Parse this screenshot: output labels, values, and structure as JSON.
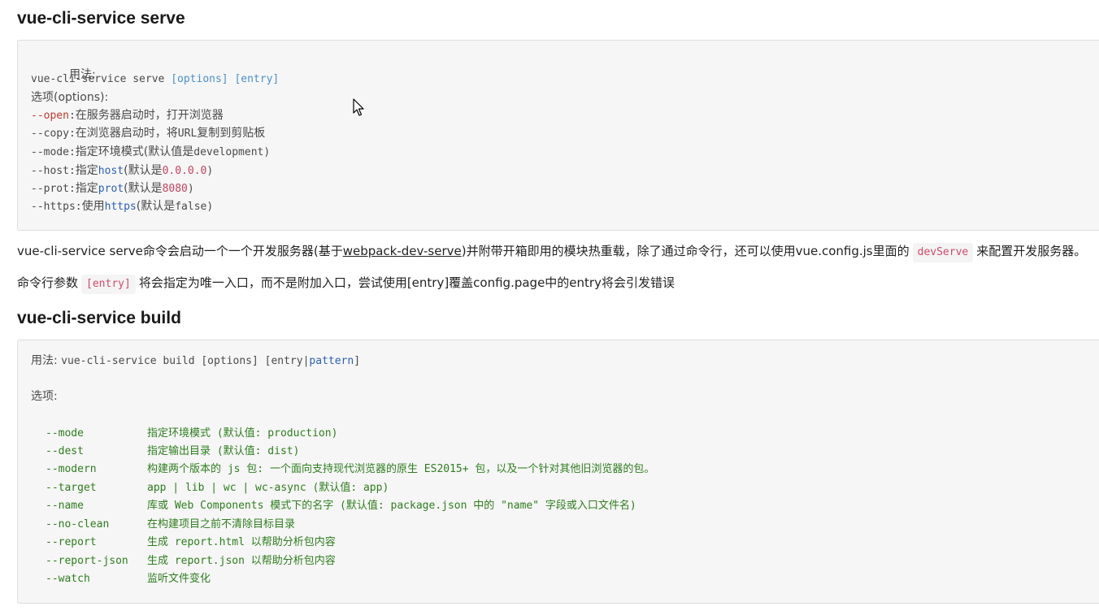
{
  "section1": {
    "heading": "vue-cli-service serve",
    "code": {
      "usage_label": "用法:",
      "usage_cmd": "vue-cli-service serve ",
      "usage_opts": "[options] [entry]",
      "options_label": "选项(options):",
      "lines": [
        {
          "flag": "--open",
          "sep": ":",
          "desc": "在服务器启动时，打开浏览器"
        },
        {
          "flag": "--copy",
          "sep": ":",
          "desc1": "在浏览器启动时，将",
          "mono": "URL",
          "desc2": "复制到剪贴板"
        },
        {
          "flag": "--mode",
          "sep": ":",
          "desc1": "指定环境模式(默认值是",
          "mono": "development",
          "desc2": ")"
        },
        {
          "flag": "--host",
          "sep": ":",
          "desc1": "指定",
          "kw": "host",
          "desc2": "(默认是",
          "val": "0.0.0.0",
          "desc3": ")"
        },
        {
          "flag": "--prot",
          "sep": ":",
          "desc1": "指定",
          "kw": "prot",
          "desc2": "(默认是",
          "val": "8080",
          "desc3": ")"
        },
        {
          "flag": "--https",
          "sep": ":",
          "desc1": "使用",
          "kw": "https",
          "desc2": "(默认是",
          "val": "false",
          "desc3": ")"
        }
      ]
    },
    "para1": {
      "part1": "vue-cli-service serve命令会启动一个一个开发服务器(基于",
      "link": "webpack-dev-serve",
      "part2": ")并附带开箱即用的模块热重载，除了通过命令行，还可以使用vue.config.js里面的",
      "code": "devServe",
      "part3": "来配置开发服务器。"
    },
    "para2": {
      "part1": "命令行参数",
      "code": "[entry]",
      "part2": "将会指定为唯一入口，而不是附加入口，尝试使用[entry]覆盖config.page中的entry将会引发错误"
    }
  },
  "section2": {
    "heading": "vue-cli-service build",
    "code": {
      "usage_label": "用法: ",
      "usage_cmd": "vue-cli-service build [options] [entry|",
      "usage_kw": "pattern",
      "usage_end": "]",
      "options_label": "选项:",
      "options": [
        {
          "flag": "--mode",
          "desc": "指定环境模式 (默认值: production)"
        },
        {
          "flag": "--dest",
          "desc": "指定输出目录 (默认值: dist)"
        },
        {
          "flag": "--modern",
          "desc": "构建两个版本的 js 包: 一个面向支持现代浏览器的原生 ES2015+ 包，以及一个针对其他旧浏览器的包。"
        },
        {
          "flag": "--target",
          "desc": "app | lib | wc | wc-async (默认值: app)"
        },
        {
          "flag": "--name",
          "desc": "库或 Web Components 模式下的名字 (默认值: package.json 中的 \"name\" 字段或入口文件名)"
        },
        {
          "flag": "--no-clean",
          "desc": "在构建项目之前不清除目标目录"
        },
        {
          "flag": "--report",
          "desc": "生成 report.html 以帮助分析包内容"
        },
        {
          "flag": "--report-json",
          "desc": "生成 report.json 以帮助分析包内容"
        },
        {
          "flag": "--watch",
          "desc": "监听文件变化"
        }
      ]
    }
  },
  "icons": {
    "cursor": "mouse-pointer-icon"
  }
}
